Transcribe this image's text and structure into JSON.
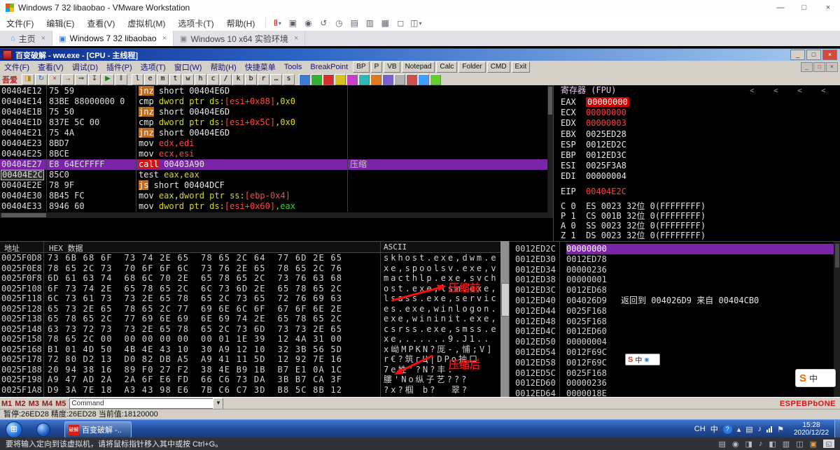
{
  "vmware": {
    "title": "Windows 7 32 libaobao - VMware Workstation",
    "window_buttons": {
      "minimize": "—",
      "maximize": "□",
      "close": "×"
    },
    "menu": [
      "文件(F)",
      "编辑(E)",
      "查看(V)",
      "虚拟机(M)",
      "选项卡(T)",
      "帮助(H)"
    ],
    "toolbar_icons": [
      {
        "name": "suspend-vm-button",
        "glyph": "‖",
        "color": "#c5372c",
        "caret": true
      },
      {
        "name": "ctrl-alt-del-button",
        "glyph": "▣"
      },
      {
        "name": "take-snapshot-button",
        "glyph": "◉"
      },
      {
        "name": "revert-snapshot-button",
        "glyph": "↺"
      },
      {
        "name": "manage-snapshots-button",
        "glyph": "◷"
      },
      {
        "name": "show-console-button",
        "glyph": "▤"
      },
      {
        "name": "show-library-button",
        "glyph": "▥"
      },
      {
        "name": "thumbnail-bar-button",
        "glyph": "▦"
      },
      {
        "name": "fullscreen-button",
        "glyph": "◻"
      },
      {
        "name": "unity-button",
        "glyph": "◫",
        "caret": true
      }
    ],
    "close_glyph": "×",
    "tabs": [
      {
        "label": "主页",
        "icon": "⌂",
        "icon_name": "home-icon",
        "icon_color": "#5a8fd8",
        "active": false
      },
      {
        "label": "Windows 7 32 libaobao",
        "icon": "▣",
        "icon_name": "vm-tab-icon",
        "icon_color": "#2f7fe8",
        "active": true
      },
      {
        "label": "Windows 10 x64 实验环境",
        "icon": "▣",
        "icon_name": "vm-tab-icon",
        "icon_color": "#8a8a8a",
        "active": false
      }
    ],
    "statusbar": {
      "hint": "要将输入定向到该虚拟机，请将鼠标指针移入其中或按 Ctrl+G。",
      "icons": [
        {
          "name": "harddisk-icon",
          "g": "▤"
        },
        {
          "name": "cdrom-icon",
          "g": "◉"
        },
        {
          "name": "network-adapter-icon",
          "g": "◨"
        },
        {
          "name": "sound-icon",
          "g": "♪"
        },
        {
          "name": "usb-icon",
          "g": "◧"
        },
        {
          "name": "printer-icon",
          "g": "▥"
        },
        {
          "name": "display-icon",
          "g": "◫"
        }
      ],
      "accent_icon": "▣",
      "corner_icon": "◱"
    }
  },
  "olly": {
    "title": "百变破解 - ww.exe - [CPU - 主线程]",
    "window_buttons": [
      "_",
      "□",
      "×"
    ],
    "mdi_buttons": [
      "_",
      "□",
      "×"
    ],
    "menu": [
      "文件(F)",
      "查看(V)",
      "调试(D)",
      "插件(P)",
      "选项(T)",
      "窗口(W)",
      "帮助(H)",
      "快捷菜单",
      "Tools",
      "BreakPoint"
    ],
    "menu_buttons": [
      "BP",
      "P",
      "VB",
      "Notepad",
      "Calc",
      "Folder",
      "CMD",
      "Exit"
    ],
    "logo": "吾爱",
    "toolbar": {
      "icon_buttons": [
        {
          "g": "◨",
          "name": "open-file-button",
          "color": "#b8860b"
        },
        {
          "g": "↻",
          "name": "restart-button",
          "color": "#2255cc"
        },
        {
          "g": "×",
          "name": "close-program-button",
          "color": "#c03030"
        },
        {
          "g": "→",
          "name": "step-into-button",
          "color": "#303030"
        },
        {
          "g": "⇒",
          "name": "step-over-button",
          "color": "#303030"
        },
        {
          "g": "↧",
          "name": "trace-into-button",
          "color": "#303030"
        },
        {
          "g": "▶",
          "name": "run-button",
          "color": "#208020"
        },
        {
          "g": "‖",
          "name": "pause-button",
          "color": "#303030"
        }
      ],
      "letter_buttons": [
        "l",
        "e",
        "m",
        "t",
        "w",
        "h",
        "c",
        "/",
        "k",
        "b",
        "r",
        "…",
        "s"
      ],
      "color_buttons": [
        "#3a7bd5",
        "#31b331",
        "#d23030",
        "#d8c020",
        "#c93fc9",
        "#2fb7b7",
        "#e07820",
        "#7a5fd0",
        "#b0b0b0",
        "#cc5050",
        "#3fa0ff",
        "#66cc33"
      ]
    },
    "disasm": {
      "rows": [
        {
          "a": "00404E12",
          "b": "75 59",
          "t": [
            [
              "jnz",
              "jmp"
            ],
            [
              " short 00404E6D",
              "w"
            ]
          ]
        },
        {
          "a": "00404E14",
          "b": "83BE 88000000 0",
          "t": [
            [
              "cmp ",
              "w"
            ],
            [
              "dword ptr ds:",
              "y"
            ],
            [
              "[esi+0x88]",
              "r"
            ],
            [
              ",0x0",
              "y"
            ]
          ]
        },
        {
          "a": "00404E1B",
          "b": "75 50",
          "t": [
            [
              "jnz",
              "jmp"
            ],
            [
              " short 00404E6D",
              "w"
            ]
          ]
        },
        {
          "a": "00404E1D",
          "b": "837E 5C 00",
          "t": [
            [
              "cmp ",
              "w"
            ],
            [
              "dword ptr ds:",
              "y"
            ],
            [
              "[esi+0x5C]",
              "r"
            ],
            [
              ",0x0",
              "y"
            ]
          ]
        },
        {
          "a": "00404E21",
          "b": "75 4A",
          "t": [
            [
              "jnz",
              "jmp"
            ],
            [
              " short 00404E6D",
              "w"
            ]
          ]
        },
        {
          "a": "00404E23",
          "b": "8BD7",
          "t": [
            [
              "mov ",
              "w"
            ],
            [
              "edx,edi",
              "r"
            ]
          ]
        },
        {
          "a": "00404E25",
          "b": "8BCE",
          "t": [
            [
              "mov ",
              "w"
            ],
            [
              "ecx,esi",
              "r"
            ]
          ]
        },
        {
          "a": "00404E27",
          "b": "E8 64ECFFFF",
          "t": [
            [
              "call",
              "call"
            ],
            [
              " 00403A90",
              "w"
            ]
          ],
          "c": "压缩",
          "sel": true
        },
        {
          "a": "00404E2C",
          "b": "85C0",
          "t": [
            [
              "test ",
              "w"
            ],
            [
              "eax,eax",
              "y"
            ]
          ],
          "eip": true
        },
        {
          "a": "00404E2E",
          "b": "78 9F",
          "t": [
            [
              "js",
              "jmp"
            ],
            [
              " short 00404DCF",
              "w"
            ]
          ]
        },
        {
          "a": "00404E30",
          "b": "8B45 FC",
          "t": [
            [
              "mov ",
              "w"
            ],
            [
              "eax",
              "y"
            ],
            [
              ",",
              "w"
            ],
            [
              "dword ptr ss:",
              "y"
            ],
            [
              "[ebp-0x4]",
              "r"
            ]
          ]
        },
        {
          "a": "00404E33",
          "b": "8946 60",
          "t": [
            [
              "mov ",
              "w"
            ],
            [
              "dword ptr ds:",
              "y"
            ],
            [
              "[esi+0x60]",
              "r"
            ],
            [
              ",eax",
              "g"
            ]
          ]
        }
      ]
    },
    "registers": {
      "pane_title": "寄存器 (FPU)",
      "collapse_marks": [
        "<",
        "<",
        "<",
        "<"
      ],
      "regs": [
        {
          "n": "EAX",
          "v": "00000000",
          "s": "hl"
        },
        {
          "n": "ECX",
          "v": "00000000",
          "s": "chg"
        },
        {
          "n": "EDX",
          "v": "00000003",
          "s": "chg"
        },
        {
          "n": "EBX",
          "v": "0025ED28",
          "s": ""
        },
        {
          "n": "ESP",
          "v": "0012ED2C",
          "s": ""
        },
        {
          "n": "EBP",
          "v": "0012ED3C",
          "s": ""
        },
        {
          "n": "ESI",
          "v": "0025F3A8",
          "s": ""
        },
        {
          "n": "EDI",
          "v": "00000004",
          "s": ""
        }
      ],
      "eip": {
        "n": "EIP",
        "v": "00404E2C",
        "s": "chg"
      },
      "flags": [
        "C 0  ES 0023 32位 0(FFFFFFFF)",
        "P 1  CS 001B 32位 0(FFFFFFFF)",
        "A 0  SS 0023 32位 0(FFFFFFFF)",
        "Z 1  DS 0023 32位 0(FFFFFFFF)"
      ]
    },
    "dump": {
      "headers": [
        "地址",
        "HEX 数据",
        "ASCII"
      ],
      "rows": [
        {
          "a": "0025F0D8",
          "h": "73 6B 68 6F  73 74 2E 65  78 65 2C 64  77 6D 2E 65",
          "t": "skhost.exe,dwm.e"
        },
        {
          "a": "0025F0E8",
          "h": "78 65 2C 73  70 6F 6F 6C  73 76 2E 65  78 65 2C 76",
          "t": "xe,spoolsv.exe,v"
        },
        {
          "a": "0025F0F8",
          "h": "6D 61 63 74  68 6C 70 2E  65 78 65 2C  73 76 63 68",
          "t": "macthlp.exe,svch"
        },
        {
          "a": "0025F108",
          "h": "6F 73 74 2E  65 78 65 2C  6C 73 6D 2E  65 78 65 2C",
          "t": "ost.exe,lsm.exe,"
        },
        {
          "a": "0025F118",
          "h": "6C 73 61 73  73 2E 65 78  65 2C 73 65  72 76 69 63",
          "t": "lsass.exe,servic"
        },
        {
          "a": "0025F128",
          "h": "65 73 2E 65  78 65 2C 77  69 6E 6C 6F  67 6F 6E 2E",
          "t": "es.exe,winlogon."
        },
        {
          "a": "0025F138",
          "h": "65 78 65 2C  77 69 6E 69  6E 69 74 2E  65 78 65 2C",
          "t": "exe,wininit.exe,"
        },
        {
          "a": "0025F148",
          "h": "63 73 72 73  73 2E 65 78  65 2C 73 6D  73 73 2E 65",
          "t": "csrss.exe,smss.e"
        },
        {
          "a": "0025F158",
          "h": "78 65 2C 00  00 00 00 00  00 01 1E 39  12 4A 31 00",
          "t": "xe,......9.J1.."
        },
        {
          "a": "0025F168",
          "h": "B1 01 4D 50  4B 4E 43 10  30 A9 12 10  32 3B 56 5D",
          "t": "x岰MPKN?厐-,悑;V]"
        },
        {
          "a": "0025F178",
          "h": "72 80 D2 13  D0 82 DB A5  A9 41 11 5D  12 92 7E 16",
          "t": "r€?筑гЦ|DPо抽口"
        },
        {
          "a": "0025F188",
          "h": "20 94 38 16  89 F0 27 F2  38 4E B9 1B  B7 E1 0A 1C",
          "t": "7е姓'?N?丰."
        },
        {
          "a": "0025F198",
          "h": "A9 47 AD 2A  2A 6F E6 FD  66 C6 73 DA  3B B7 CA 3F",
          "t": "膢'Nо纵子艺???"
        },
        {
          "a": "0025F1A8",
          "h": "D9 3A 7E 18  A3 43 98 E6  7B C6 C7 3D  B8 5C 8B 12",
          "t": "?x?椢 b?  翠?"
        }
      ]
    },
    "stack": {
      "rows": [
        {
          "a": "0012ED2C",
          "v": "00000000",
          "sel": true
        },
        {
          "a": "0012ED30",
          "v": "0012ED78"
        },
        {
          "a": "0012ED34",
          "v": "00000236"
        },
        {
          "a": "0012ED38",
          "v": "00000001"
        },
        {
          "a": "0012ED3C",
          "v": "0012ED68"
        },
        {
          "a": "0012ED40",
          "v": "004026D9",
          "c": "返回到 004026D9 来自 00404CB0"
        },
        {
          "a": "0012ED44",
          "v": "0025F168"
        },
        {
          "a": "0012ED48",
          "v": "0025F168"
        },
        {
          "a": "0012ED4C",
          "v": "0012ED60"
        },
        {
          "a": "0012ED50",
          "v": "00000004"
        },
        {
          "a": "0012ED54",
          "v": "0012F69C"
        },
        {
          "a": "0012ED58",
          "v": "0012F69C"
        },
        {
          "a": "0012ED5C",
          "v": "0025F168"
        },
        {
          "a": "0012ED60",
          "v": "00000236"
        },
        {
          "a": "0012ED64",
          "v": "0000018E"
        }
      ]
    },
    "cmdbar": {
      "m_buttons": [
        "M1",
        "M2",
        "M3",
        "M4",
        "M5"
      ],
      "command_text": "Command",
      "drop_glyph": "▼",
      "right_text": "ESPEBPbONE"
    },
    "status": "暂停:26ED28 精度:26ED28 当前值:18120000"
  },
  "taskbar": {
    "start_glyph": "⊞",
    "app": {
      "icon_text": "破解",
      "label": "百变破解 -..."
    },
    "tray": {
      "lang": [
        "CH",
        "中",
        "?"
      ],
      "icons": [
        {
          "name": "show-hidden-icons-arrow",
          "g": "▴"
        },
        {
          "name": "action-center-icon",
          "g": "▤"
        },
        {
          "name": "volume-icon",
          "g": "♪"
        },
        {
          "name": "network-icon",
          "g": "bars"
        },
        {
          "name": "flag-icon",
          "g": "⚑"
        }
      ],
      "time": "15:28",
      "date": "2020/12/22"
    }
  },
  "sogou": {
    "pill_small": {
      "logo": "S",
      "lang": "中",
      "dot": "◉"
    },
    "pill_large": {
      "logo": "S",
      "lang": "中"
    }
  },
  "annotations": {
    "before": "压缩前",
    "after": "压缩后",
    "color": "#f01212"
  }
}
